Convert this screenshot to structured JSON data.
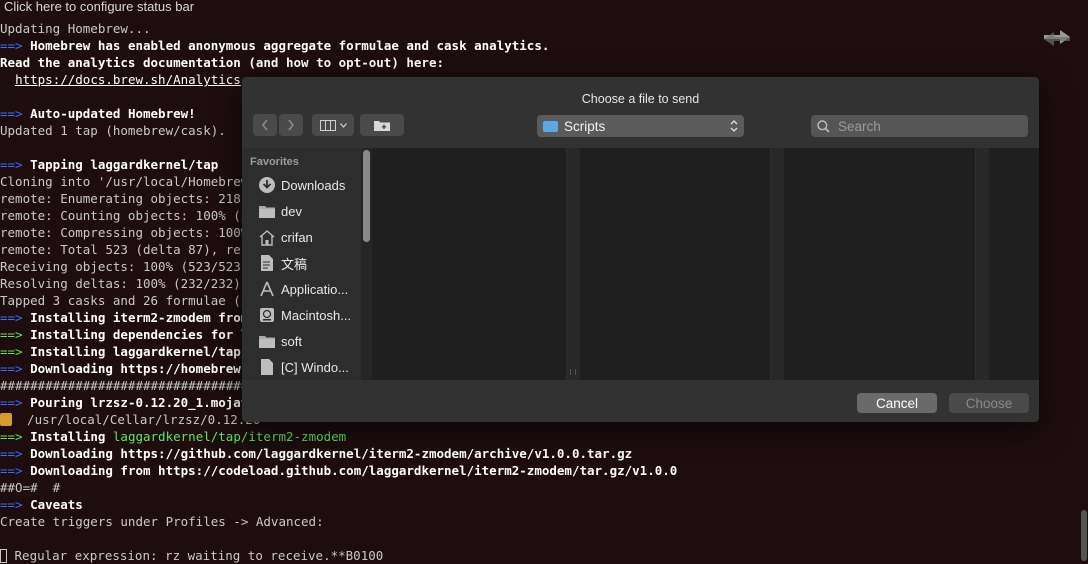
{
  "statusbar": {
    "label": "Click here to configure status bar"
  },
  "terminal": {
    "lines": [
      [
        {
          "t": "Updating Homebrew...",
          "c": "normal"
        }
      ],
      [
        {
          "t": "==> ",
          "c": "arrow"
        },
        {
          "t": "Homebrew has enabled anonymous aggregate formulae and cask analytics.",
          "c": "bold"
        }
      ],
      [
        {
          "t": "Read the analytics documentation (and how to opt-out) here:",
          "c": "bold"
        }
      ],
      [
        {
          "t": "  ",
          "c": "normal"
        },
        {
          "t": "https://docs.brew.sh/Analytics",
          "c": "url"
        }
      ],
      [
        {
          "t": "",
          "c": "normal"
        }
      ],
      [
        {
          "t": "==> ",
          "c": "arrow"
        },
        {
          "t": "Auto-updated Homebrew!",
          "c": "bold"
        }
      ],
      [
        {
          "t": "Updated 1 tap (homebrew/cask).",
          "c": "normal"
        }
      ],
      [
        {
          "t": "",
          "c": "normal"
        }
      ],
      [
        {
          "t": "==> ",
          "c": "arrow"
        },
        {
          "t": "Tapping laggardkernel/tap",
          "c": "bold"
        }
      ],
      [
        {
          "t": "Cloning into '/usr/local/Homebrew/",
          "c": "normal"
        }
      ],
      [
        {
          "t": "remote: Enumerating objects: 218, ",
          "c": "normal"
        }
      ],
      [
        {
          "t": "remote: Counting objects: 100% (21",
          "c": "normal"
        }
      ],
      [
        {
          "t": "remote: Compressing objects: 100% ",
          "c": "normal"
        }
      ],
      [
        {
          "t": "remote: Total 523 (delta 87), reus",
          "c": "normal"
        }
      ],
      [
        {
          "t": "Receiving objects: 100% (523/523),",
          "c": "normal"
        }
      ],
      [
        {
          "t": "Resolving deltas: 100% (232/232), ",
          "c": "normal"
        }
      ],
      [
        {
          "t": "Tapped 3 casks and 26 formulae (55",
          "c": "normal"
        }
      ],
      [
        {
          "t": "==> ",
          "c": "arrow"
        },
        {
          "t": "Installing iterm2-zmodem from ",
          "c": "bold"
        }
      ],
      [
        {
          "t": "==> ",
          "c": "arrow-green"
        },
        {
          "t": "Installing dependencies for la",
          "c": "bold"
        }
      ],
      [
        {
          "t": "==> ",
          "c": "arrow-green"
        },
        {
          "t": "Installing laggardkernel/tap/i",
          "c": "bold"
        }
      ],
      [
        {
          "t": "==> ",
          "c": "arrow"
        },
        {
          "t": "Downloading https://homebrew.b",
          "c": "bold"
        }
      ],
      [
        {
          "t": "##################################",
          "c": "normal"
        }
      ],
      [
        {
          "t": "==> ",
          "c": "arrow"
        },
        {
          "t": "Pouring lrzsz-0.12.20_1.mojave",
          "c": "bold"
        }
      ],
      [
        {
          "t": "BEER",
          "c": "beer"
        },
        {
          "t": "  /usr/local/Cellar/lrzsz/0.12.20",
          "c": "normal"
        }
      ],
      [
        {
          "t": "==> ",
          "c": "arrow-green"
        },
        {
          "t": "Installing ",
          "c": "bold"
        },
        {
          "t": "laggardkernel/tap/iterm2-zmodem",
          "c": "greenpkg"
        }
      ],
      [
        {
          "t": "==> ",
          "c": "arrow"
        },
        {
          "t": "Downloading https://github.com/laggardkernel/iterm2-zmodem/archive/v1.0.0.tar.gz",
          "c": "bold"
        }
      ],
      [
        {
          "t": "==> ",
          "c": "arrow"
        },
        {
          "t": "Downloading from https://codeload.github.com/laggardkernel/iterm2-zmodem/tar.gz/v1.0.0",
          "c": "bold"
        }
      ],
      [
        {
          "t": "##O=#  #",
          "c": "normal"
        }
      ],
      [
        {
          "t": "==> ",
          "c": "arrow"
        },
        {
          "t": "Caveats",
          "c": "bold"
        }
      ],
      [
        {
          "t": "Create triggers under Profiles -> Advanced:",
          "c": "normal"
        }
      ],
      [
        {
          "t": "",
          "c": "normal"
        }
      ],
      [
        {
          "t": "CURSOR",
          "c": "cursor"
        },
        {
          "t": " Regular expression: rz waiting to receive.**B0100",
          "c": "normal"
        }
      ]
    ]
  },
  "dialog": {
    "title": "Choose a file to send",
    "location": "Scripts",
    "search_placeholder": "Search",
    "sidebar_heading": "Favorites",
    "sidebar_items": [
      {
        "label": "Downloads",
        "icon": "download-icon"
      },
      {
        "label": "dev",
        "icon": "folder-icon"
      },
      {
        "label": "crifan",
        "icon": "home-icon"
      },
      {
        "label": "文稿",
        "icon": "documents-icon"
      },
      {
        "label": "Applicatio...",
        "icon": "applications-icon"
      },
      {
        "label": "Macintosh...",
        "icon": "disk-icon"
      },
      {
        "label": "soft",
        "icon": "folder-icon"
      },
      {
        "label": "[C] Windo...",
        "icon": "document-icon"
      }
    ],
    "cancel_label": "Cancel",
    "choose_label": "Choose"
  },
  "colors": {
    "terminal_bg": "#1d0d0f",
    "arrow_blue": "#3b6cff",
    "arrow_green": "#5ee85e",
    "dialog_bg": "#323232",
    "folder_accent": "#5aa8e6"
  }
}
